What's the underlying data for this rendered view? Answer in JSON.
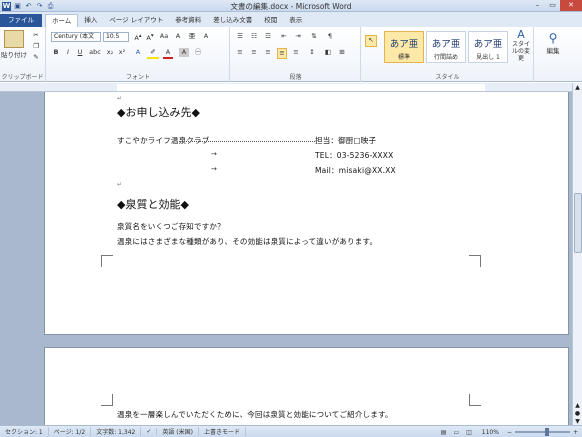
{
  "window": {
    "title": "文書の編集.docx - Microsoft Word"
  },
  "qat": {
    "save_icon": "save-icon",
    "undo": "↶",
    "redo": "↷",
    "print": "⎙"
  },
  "tabs": [
    "ファイル",
    "ホーム",
    "挿入",
    "ページ レイアウト",
    "参考資料",
    "差し込み文書",
    "校閲",
    "表示"
  ],
  "ribbon": {
    "clipboard": {
      "paste": "貼り付け",
      "label": "クリップボード"
    },
    "font": {
      "name": "Century (本文",
      "size": "10.5",
      "label": "フォント"
    },
    "paragraph": {
      "label": "段落"
    },
    "styles": {
      "label": "スタイル",
      "items": [
        {
          "sample": "あア亜",
          "name": "標準"
        },
        {
          "sample": "あア亜",
          "name": "行間詰め"
        },
        {
          "sample": "あア亜",
          "name": "見出し 1"
        }
      ],
      "change": "スタイルの変更"
    },
    "editing": {
      "label": "編集"
    }
  },
  "document": {
    "heading1": "◆お申し込み先◆",
    "club": "すこやかライフ温泉クラブ",
    "contact_name": "担当：御厨□映子",
    "tel": "TEL：03-5236-XXXX",
    "mail": "Mail：misaki@XX.XX",
    "tab_arrow": "→",
    "heading2": "◆泉質と効能◆",
    "q1": "泉質名をいくつご存知ですか？",
    "q2": "温泉にはさまざまな種類があり、その効能は泉質によって違いがあります。",
    "p2": "温泉を一層楽しんでいただくために、今回は泉質と効能についてご紹介します。",
    "para_mark": "↵"
  },
  "status": {
    "section": "セクション: 1",
    "page": "ページ: 1/2",
    "words": "文字数: 1,342",
    "lang": "英語 (米国)",
    "mode": "上書きモード",
    "zoom": "110%"
  }
}
